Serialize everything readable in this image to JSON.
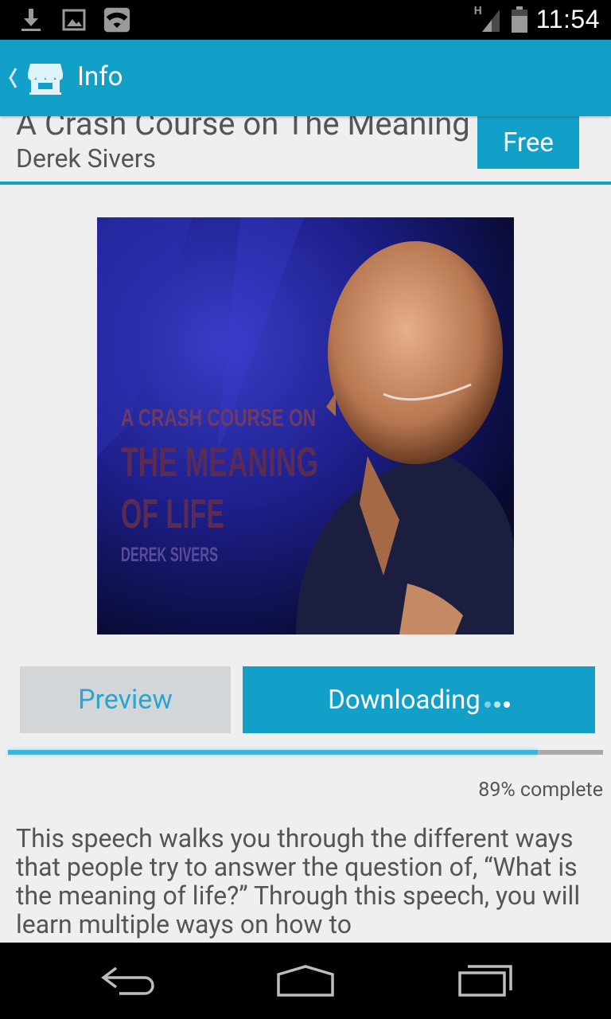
{
  "status_bar": {
    "time": "11:54",
    "network_label": "H",
    "icons": [
      "download-icon",
      "image-icon",
      "wifi-icon",
      "signal-icon",
      "battery-icon"
    ]
  },
  "app_bar": {
    "title": "Info",
    "icon": "store-icon"
  },
  "book": {
    "title": "A Crash Course on The Meaning of Life",
    "author": "Derek Sivers",
    "price_label": "Free",
    "cover": {
      "line1": "A CRASH COURSE ON",
      "line2": "THE MEANING",
      "line3": "OF LIFE",
      "author": "DEREK SIVERS"
    }
  },
  "actions": {
    "preview_label": "Preview",
    "downloading_label": "Downloading"
  },
  "progress": {
    "percent": 89,
    "label": "89% complete"
  },
  "description": "This speech walks you through the different ways that people try to answer the question of, “What is the meaning of life?” Through this speech, you will learn multiple ways on how to",
  "colors": {
    "accent": "#13a0c8",
    "text": "#555555",
    "background": "#efefef"
  },
  "nav_bar": {
    "icons": [
      "back-icon",
      "home-icon",
      "recent-apps-icon"
    ]
  }
}
